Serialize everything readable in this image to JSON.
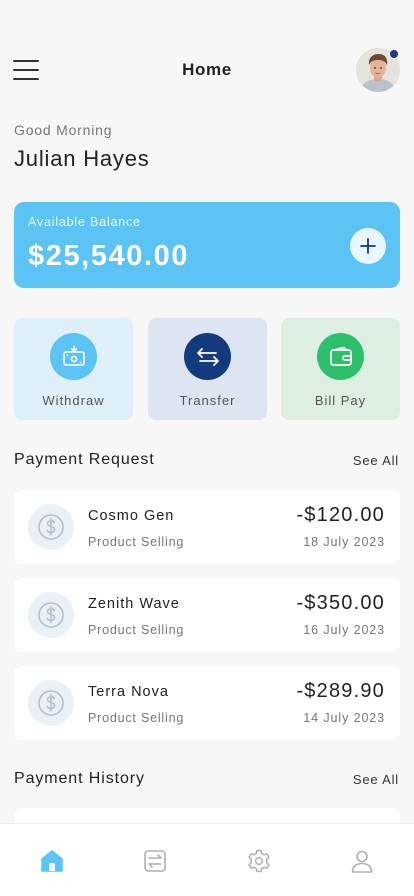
{
  "header": {
    "title": "Home",
    "menu_icon": "hamburger-menu-icon",
    "avatar": "user-avatar",
    "notification_color": "#1a3a8a"
  },
  "greeting": {
    "text": "Good Morning",
    "name": "Julian Hayes"
  },
  "balance": {
    "label": "Available Balance",
    "amount": "$25,540.00",
    "add_icon": "plus-icon",
    "card_color": "#5bc4f5"
  },
  "actions": [
    {
      "label": "Withdraw",
      "icon": "withdraw-icon",
      "color": "#5bc4f5"
    },
    {
      "label": "Transfer",
      "icon": "transfer-arrows-icon",
      "color": "#123a7d"
    },
    {
      "label": "Bill Pay",
      "icon": "wallet-icon",
      "color": "#2dbf6c"
    }
  ],
  "payment_request": {
    "title": "Payment Request",
    "see_all": "See All",
    "items": [
      {
        "name": "Cosmo Gen",
        "subtitle": "Product Selling",
        "amount": "-$120.00",
        "date": "18 July 2023",
        "icon": "dollar-coin-icon"
      },
      {
        "name": "Zenith Wave",
        "subtitle": "Product Selling",
        "amount": "-$350.00",
        "date": "16 July 2023",
        "icon": "dollar-coin-icon"
      },
      {
        "name": "Terra Nova",
        "subtitle": "Product Selling",
        "amount": "-$289.90",
        "date": "14 July 2023",
        "icon": "dollar-coin-icon"
      }
    ]
  },
  "payment_history": {
    "title": "Payment History",
    "see_all": "See All"
  },
  "bottom_nav": {
    "items": [
      {
        "icon": "home-icon",
        "active": true
      },
      {
        "icon": "transactions-icon",
        "active": false
      },
      {
        "icon": "settings-gear-icon",
        "active": false
      },
      {
        "icon": "profile-icon",
        "active": false
      }
    ],
    "active_color": "#5bc4f5",
    "inactive_color": "#b0b0b0"
  }
}
